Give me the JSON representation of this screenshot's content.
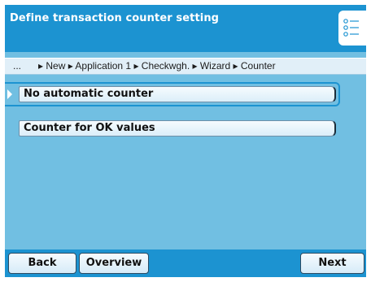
{
  "header": {
    "title": "Define transaction counter setting",
    "menu_icon": "list-icon"
  },
  "breadcrumb": {
    "ellipsis": "...",
    "path": "▸ New ▸ Application 1 ▸ Checkwgh. ▸ Wizard ▸ Counter"
  },
  "options": [
    {
      "label": "No automatic counter",
      "selected": true
    },
    {
      "label": "Counter for OK values",
      "selected": false
    }
  ],
  "footer": {
    "back": "Back",
    "overview": "Overview",
    "next": "Next"
  },
  "colors": {
    "header_bg": "#1c93d1",
    "content_bg": "#71bfe2",
    "breadcrumb_bg": "#e1eff8"
  }
}
